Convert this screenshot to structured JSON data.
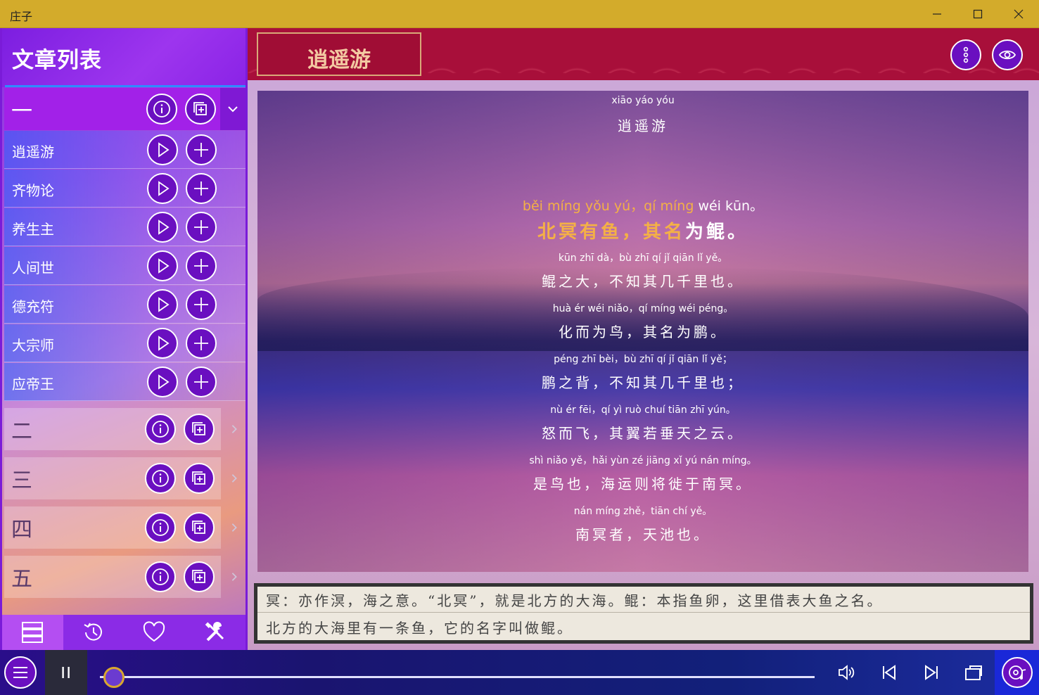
{
  "window": {
    "title": "庄子"
  },
  "sidebar": {
    "title": "文章列表",
    "groups": [
      {
        "label": "一",
        "expanded": true
      },
      {
        "label": "二",
        "expanded": false
      },
      {
        "label": "三",
        "expanded": false
      },
      {
        "label": "四",
        "expanded": false
      },
      {
        "label": "五",
        "expanded": false
      }
    ],
    "chapters": [
      "逍遥游",
      "齐物论",
      "养生主",
      "人间世",
      "德充符",
      "大宗师",
      "应帝王"
    ],
    "footer_tabs": [
      {
        "icon": "list-icon",
        "active": true
      },
      {
        "icon": "history-icon",
        "active": false
      },
      {
        "icon": "heart-icon",
        "active": false
      },
      {
        "icon": "tools-icon",
        "active": false
      }
    ]
  },
  "main": {
    "title": "逍遥游",
    "heading_pinyin": "xiāo yáo yóu",
    "heading_hanzi": "逍遥游",
    "verses": [
      {
        "pinyin_hl": "běi míng yǒu yú，qí míng",
        "pinyin_rest": " wéi kūn。",
        "hanzi_hl": "北冥有鱼，其名",
        "hanzi_rest": "为鲲。",
        "current": true
      },
      {
        "pinyin": "kūn zhī dà，bù zhī qí jǐ qiān lǐ yě。",
        "hanzi": "鲲之大，不知其几千里也。"
      },
      {
        "pinyin": "huà ér wéi niǎo，qí míng wéi péng。",
        "hanzi": "化而为鸟，其名为鹏。"
      },
      {
        "pinyin": "péng zhī bèi，bù zhī qí jǐ qiān lǐ yě；",
        "hanzi": "鹏之背，不知其几千里也；"
      },
      {
        "pinyin": "nù ér fēi，qí yì ruò chuí tiān zhī yún。",
        "hanzi": "怒而飞，其翼若垂天之云。"
      },
      {
        "pinyin": "shì niǎo yě，hǎi yùn zé jiāng xǐ yú nán míng。",
        "hanzi": "是鸟也，海运则将徙于南冥。"
      },
      {
        "pinyin": "nán míng zhě，tiān chí yě。",
        "hanzi": "南冥者，天池也。"
      }
    ],
    "notes": [
      "冥：亦作溟，海之意。“北冥”，就是北方的大海。鲲：本指鱼卵，这里借表大鱼之名。",
      "北方的大海里有一条鱼，它的名字叫做鲲。"
    ]
  },
  "player": {
    "progress": 0.02
  },
  "colors": {
    "accent": "#7a1bd8",
    "highlight": "#f4b046",
    "titlebar": "#d3ab2b",
    "header": "#a80f3a"
  }
}
